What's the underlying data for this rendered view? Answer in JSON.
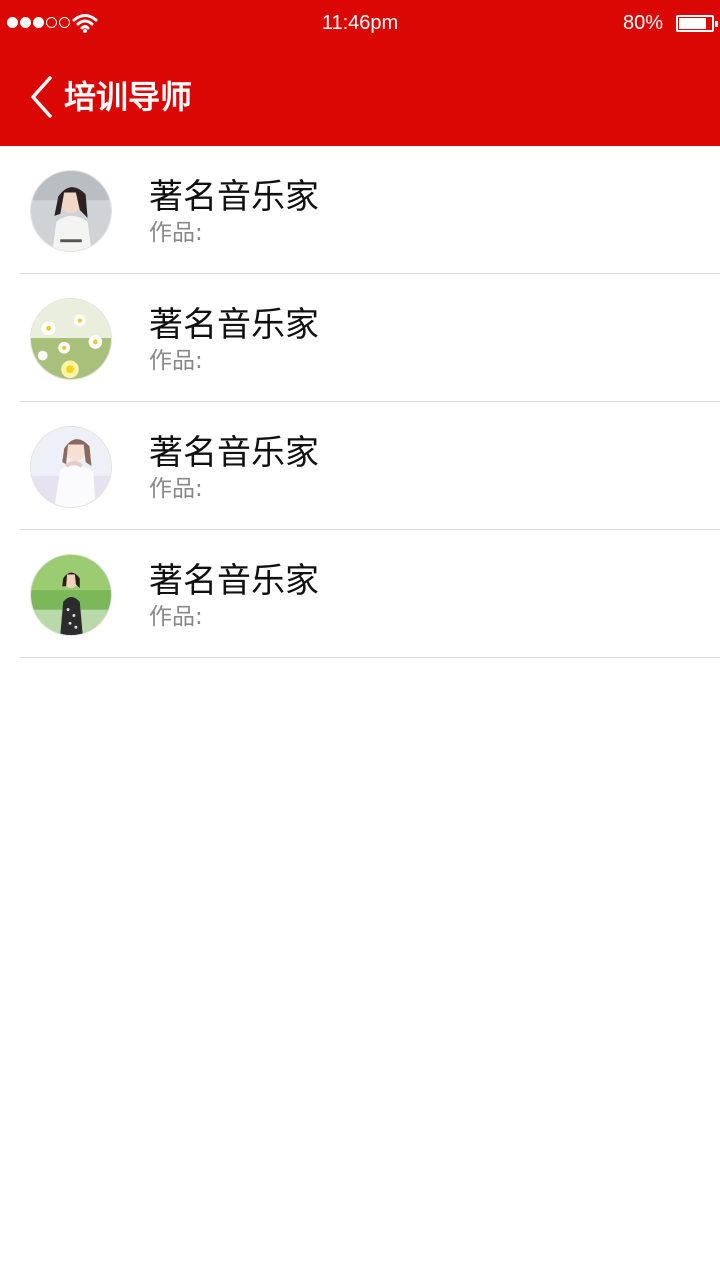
{
  "status_bar": {
    "time": "11:46pm",
    "battery_percent": "80%",
    "signal_bars_filled": 3,
    "signal_bars_total": 5,
    "battery_level": 0.8
  },
  "nav": {
    "title": "培训导师",
    "back_icon": "chevron-left-icon"
  },
  "colors": {
    "header_bg": "#da0705",
    "divider": "#d9d9d9",
    "subtitle": "#888888"
  },
  "mentors": [
    {
      "name": "著名音乐家",
      "works_label": "作品:"
    },
    {
      "name": "著名音乐家",
      "works_label": "作品:"
    },
    {
      "name": "著名音乐家",
      "works_label": "作品:"
    },
    {
      "name": "著名音乐家",
      "works_label": "作品:"
    }
  ]
}
